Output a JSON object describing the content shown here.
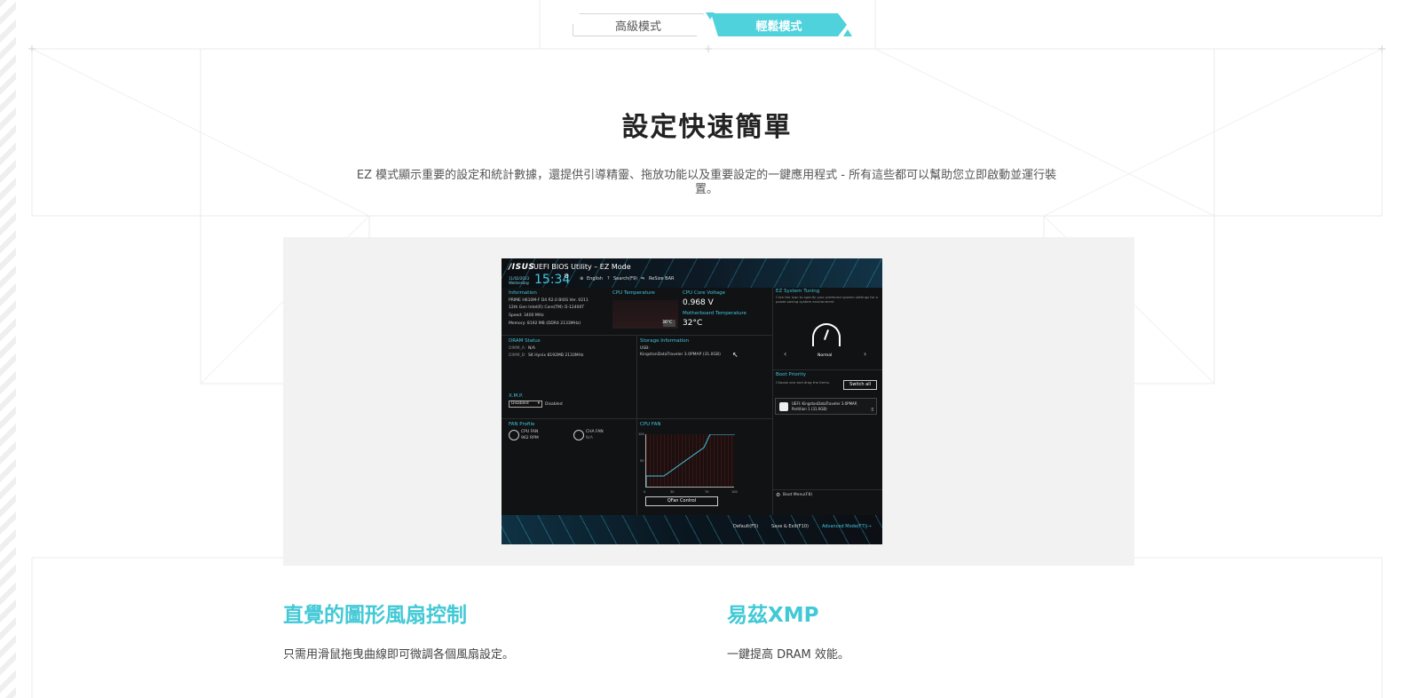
{
  "tabs": {
    "advanced_label": "高級模式",
    "ez_label": "輕鬆模式",
    "active_color": "#4fd2dc"
  },
  "hero": {
    "title": "設定快速簡單",
    "description": "EZ 模式顯示重要的設定和統計數據，還提供引導精靈、拖放功能以及重要設定的一鍵應用程式 - 所有這些都可以幫助您立即啟動並運行裝置。"
  },
  "bios": {
    "logo": "/ISUS",
    "title": "UEFI BIOS Utility – EZ Mode",
    "date": "11/02/2023 Wednesday",
    "time": "15:34",
    "toolbar": {
      "language": "English",
      "search": "Search(F9)",
      "rebar": "ReSize BAR"
    },
    "information": {
      "label": "Information",
      "line1": "PRIME H610M-F D4 R2.0    BIOS Ver. 0211",
      "line2": "12th Gen Intel(R) Core(TM) i5-12400T",
      "line3": "Speed: 3400 MHz",
      "line4": "Memory: 8192 MB (DDR4 2133MHz)"
    },
    "cpu_temp": {
      "label": "CPU Temperature",
      "value": "36°C"
    },
    "cpu_voltage": {
      "label": "CPU Core Voltage",
      "value": "0.968 V"
    },
    "mb_temp": {
      "label": "Motherboard Temperature",
      "value": "32°C"
    },
    "dram": {
      "label": "DRAM Status",
      "line1_slot": "DIMM_A:",
      "line1_value": "N/A",
      "line2_slot": "DIMM_B:",
      "line2_value": "SK Hynix 8192MB 2133MHz"
    },
    "storage": {
      "label": "Storage Information",
      "type": "USB:",
      "device": "KingstonDataTraveler 3.0PMAP (31.0GB)"
    },
    "xmp": {
      "label": "X.M.P.",
      "select": "Disabled",
      "status": "Disabled"
    },
    "fan_profile": {
      "label": "FAN Profile",
      "fan1_name": "CPU FAN",
      "fan1_value": "962 RPM",
      "fan2_name": "CHA FAN",
      "fan2_value": "N/A"
    },
    "cpu_fan": {
      "label": "CPU FAN",
      "y_top": "100",
      "y_mid": "50",
      "x0": "0",
      "x30": "30",
      "x70": "70",
      "x100": "100",
      "qfan_button": "QFan Control"
    },
    "ez_tuning": {
      "label": "EZ System Tuning",
      "desc": "Click the icon to specify your preferred system settings for a power-saving system environment",
      "mode": "Normal",
      "prev": "‹",
      "next": "›"
    },
    "boot_priority": {
      "label": "Boot Priority",
      "desc": "Choose one and drag the items.",
      "switch_all": "Switch all",
      "item_line1": "UEFI: KingstonDataTraveler 3.0PMAP,",
      "item_line2": "Partition 1 (31.0GB)"
    },
    "boot_menu": "Boot Menu(F8)",
    "footer": {
      "default": "Default(F5)",
      "save_exit": "Save & Exit(F10)",
      "advanced": "Advanced Mode(F7)|→"
    }
  },
  "features": [
    {
      "title": "直覺的圖形風扇控制",
      "desc": "只需用滑鼠拖曳曲線即可微調各個風扇設定。"
    },
    {
      "title": "易茲XMP",
      "desc": "一鍵提高 DRAM 效能。"
    }
  ]
}
